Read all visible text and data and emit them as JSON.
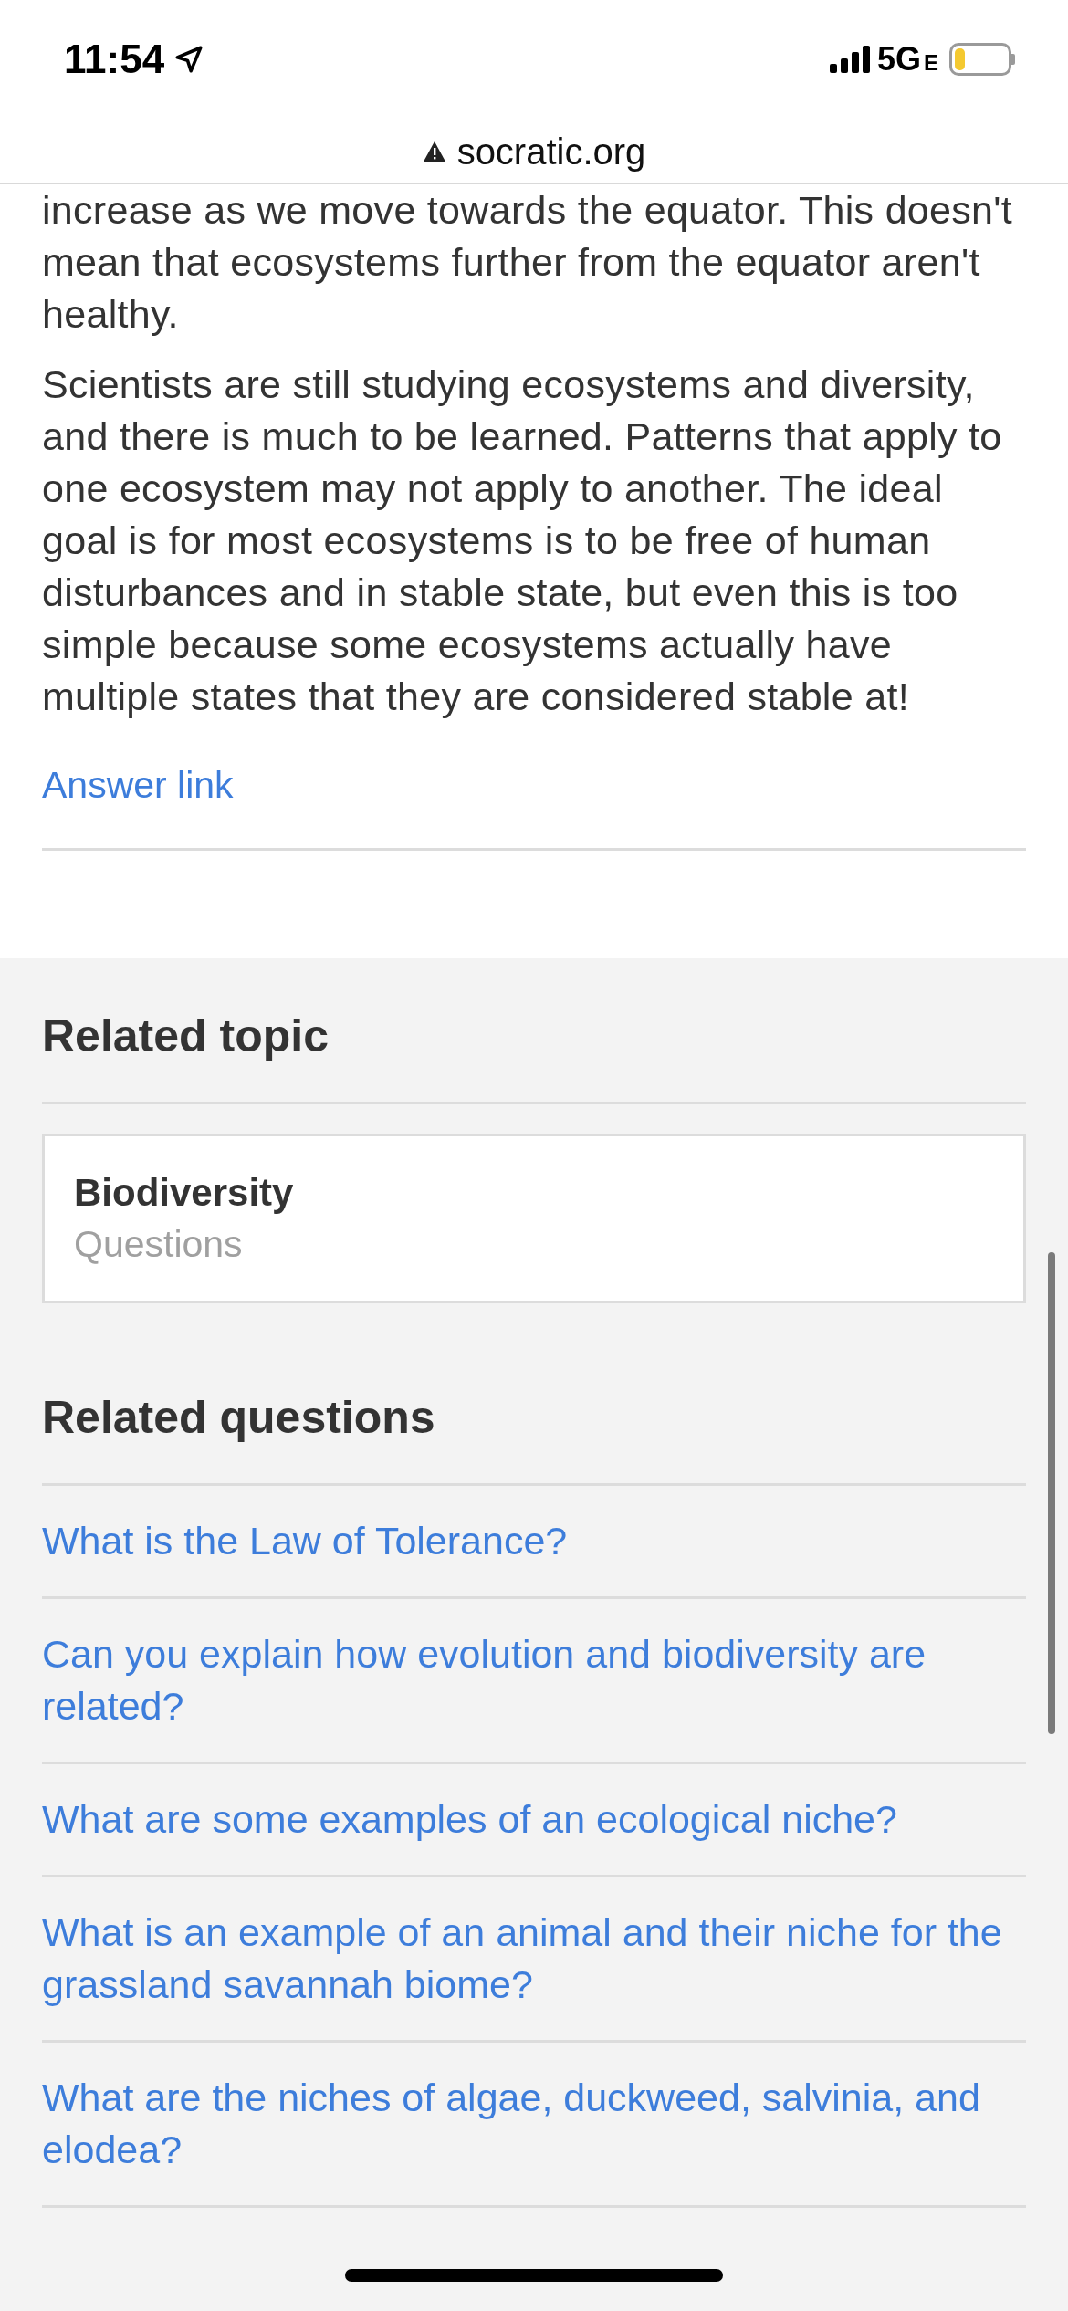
{
  "status_bar": {
    "time": "11:54",
    "network": "5G",
    "network_suffix": "E"
  },
  "address_bar": {
    "domain": "socratic.org"
  },
  "answer": {
    "paragraphs": [
      "increase as we move towards the equator. This doesn't mean that ecosystems further from the equator aren't healthy.",
      "Scientists are still studying ecosystems and diversity, and there is much to be learned. Patterns that apply to one ecosystem may not apply to another. The ideal goal is for most ecosystems is to be free of human disturbances and in stable state, but even this is too simple because some ecosystems actually have multiple states that they are considered stable at!"
    ],
    "link": "Answer link"
  },
  "related_topic": {
    "heading": "Related topic",
    "card": {
      "title": "Biodiversity",
      "subtitle": "Questions"
    }
  },
  "related_questions": {
    "heading": "Related questions",
    "items": [
      "What is the Law of Tolerance?",
      "Can you explain how evolution and biodiversity are related?",
      "What are some examples of an ecological niche?",
      "What is an example of an animal and their niche for the grassland savannah biome?",
      "What are the niches of algae, duckweed, salvinia, and elodea?"
    ]
  }
}
